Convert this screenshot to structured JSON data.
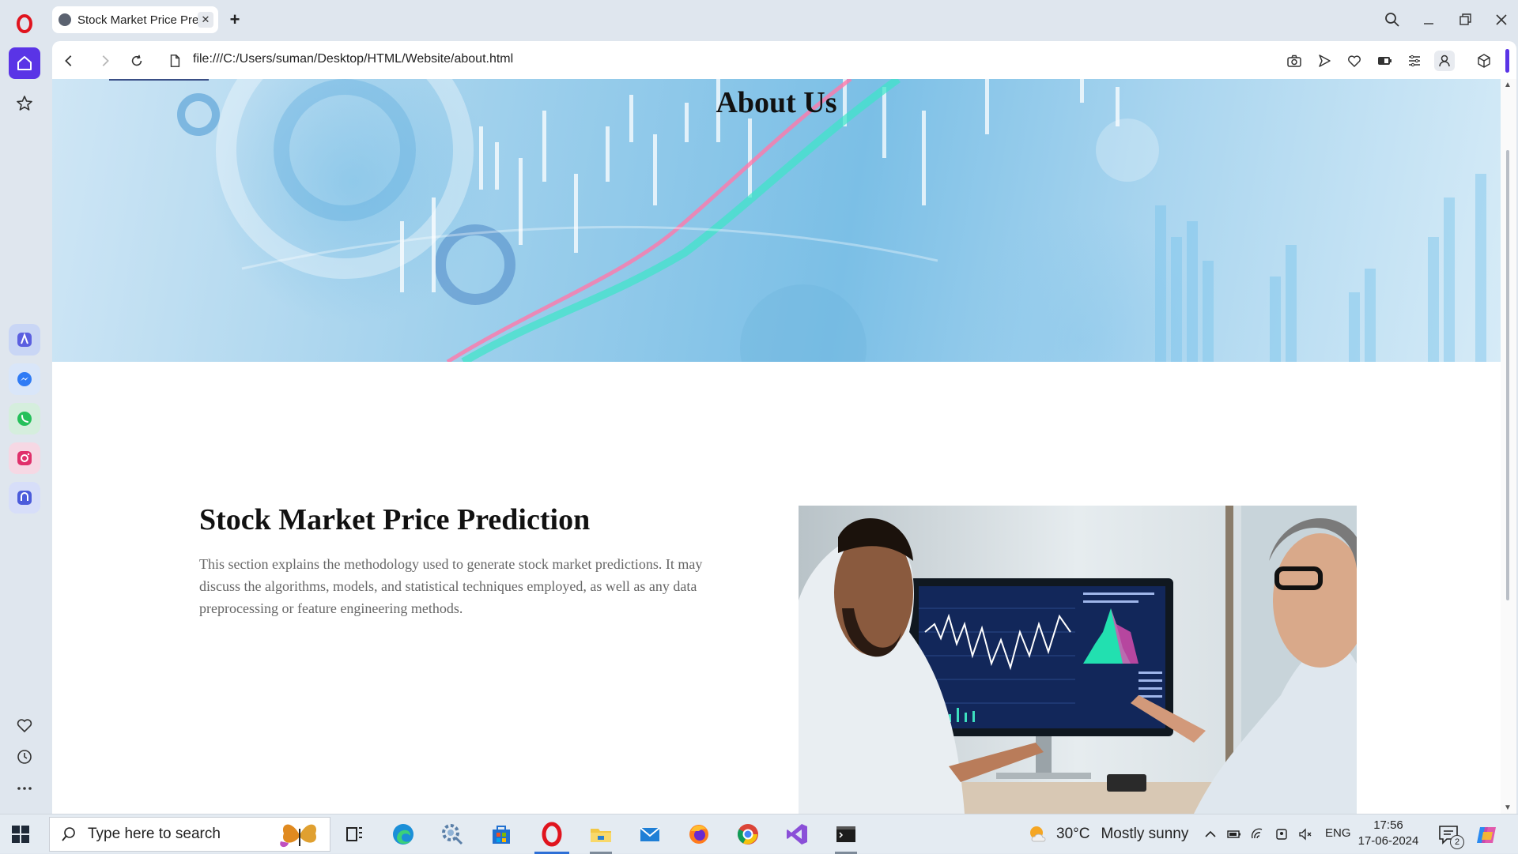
{
  "browser": {
    "tab": {
      "title": "Stock Market Price Pre",
      "close_label": "✕"
    },
    "new_tab_label": "+",
    "address": "file:///C:/Users/suman/Desktop/HTML/Website/about.html",
    "accent_color": "#5a34e6"
  },
  "sidebar": {
    "items": [
      "opera-logo",
      "home-icon",
      "star-icon",
      "aria-icon",
      "messenger-icon",
      "whatsapp-icon",
      "instagram-icon",
      "player-icon",
      "heart-icon",
      "history-icon",
      "more-icon"
    ]
  },
  "page": {
    "hero_title": "About Us",
    "section_title": "Stock Market Price Prediction",
    "section_text": "This section explains the methodology used to generate stock market predictions. It may discuss the algorithms, models, and statistical techniques employed, as well as any data preprocessing or feature engineering methods."
  },
  "taskbar": {
    "search_placeholder": "Type here to search",
    "weather_temp": "30°C",
    "weather_text": "Mostly sunny",
    "language": "ENG",
    "time": "17:56",
    "date": "17-06-2024",
    "notification_count": "2"
  }
}
